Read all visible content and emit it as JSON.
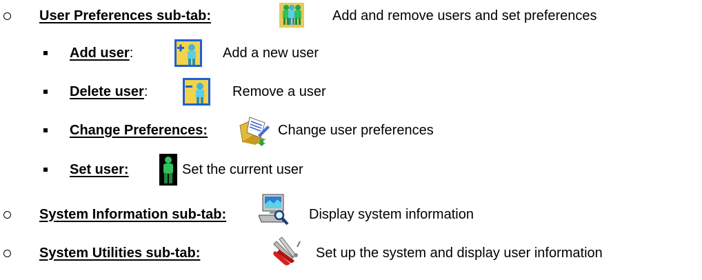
{
  "items": [
    {
      "title": "User Preferences sub-tab:",
      "description": "Add and remove users and set preferences",
      "icon": "user-preferences-icon"
    },
    {
      "title": "Add user",
      "separator": ":",
      "description": "Add a new user",
      "icon": "add-user-icon"
    },
    {
      "title": "Delete user",
      "separator": ":",
      "description": "Remove a user",
      "icon": "delete-user-icon"
    },
    {
      "title": "Change Preferences:",
      "description": "Change user preferences",
      "icon": "change-preferences-icon"
    },
    {
      "title": "Set user:",
      "description": "Set the current user",
      "icon": "set-user-icon"
    },
    {
      "title": "System Information sub-tab:",
      "description": "Display system information",
      "icon": "system-information-icon"
    },
    {
      "title": "System Utilities sub-tab:",
      "description": "Set up the system and display user information",
      "icon": "system-utilities-icon"
    }
  ]
}
